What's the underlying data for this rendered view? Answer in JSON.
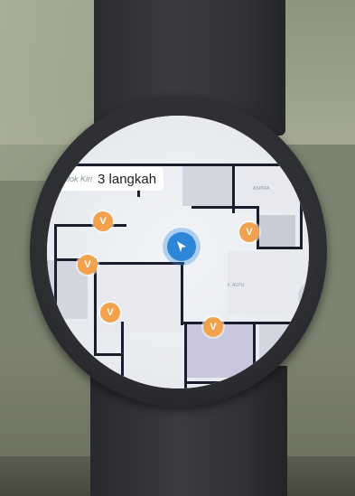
{
  "direction": {
    "instruction": "Belok Kiri",
    "steps": "3 langkah"
  },
  "map": {
    "rooms": [
      "ASPIRA",
      "F. ALPU"
    ],
    "markers": [
      "V",
      "V",
      "V",
      "V",
      "V"
    ]
  },
  "controls": {
    "zoom_in": "+"
  },
  "colors": {
    "marker": "#f2a24c",
    "location": "#2e86d8",
    "wall": "#1c1d2c"
  }
}
